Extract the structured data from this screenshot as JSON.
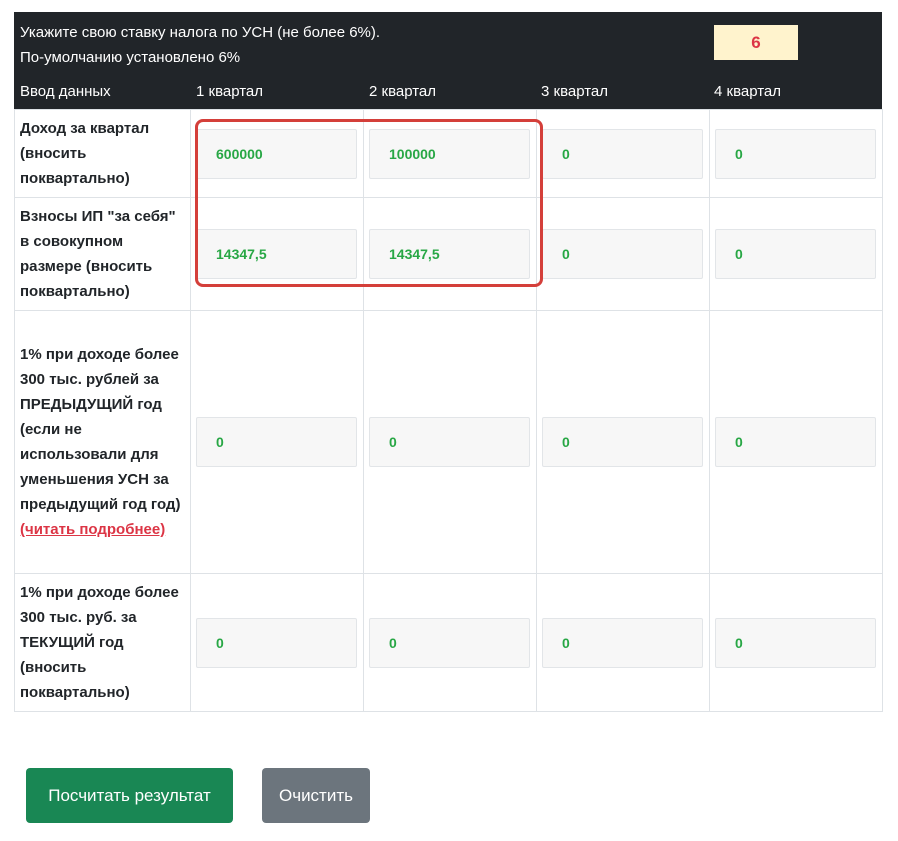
{
  "header": {
    "rate_line1": "Укажите свою ставку налога по УСН (не более 6%).",
    "rate_line2": "По-умолчанию установлено 6%",
    "rate_value": "6",
    "columns": [
      "Ввод данных",
      "1 квартал",
      "2 квартал",
      "3 квартал",
      "4 квартал"
    ]
  },
  "rows": [
    {
      "label": "Доход за квартал (вносить поквартально)",
      "values": [
        "600000",
        "100000",
        "0",
        "0"
      ]
    },
    {
      "label": "Взносы ИП \"за себя\" в совокупном размере (вносить поквартально)",
      "values": [
        "14347,5",
        "14347,5",
        "0",
        "0"
      ]
    },
    {
      "label": "1% при доходе более 300 тыс. рублей за ПРЕДЫДУЩИЙ год (если не использовали для уменьшения УСН за предыдущий год год)",
      "link": "(читать подробнее)",
      "values": [
        "0",
        "0",
        "0",
        "0"
      ]
    },
    {
      "label": "1% при доходе более 300 тыс. руб. за ТЕКУЩИЙ год (вносить поквартально)",
      "values": [
        "0",
        "0",
        "0",
        "0"
      ]
    }
  ],
  "buttons": {
    "calculate": "Посчитать результат",
    "clear": "Очистить"
  },
  "colors": {
    "header_bg": "#212529",
    "value_text": "#28a745",
    "rate_text": "#dc3545",
    "rate_bg": "#fff3cd",
    "highlight": "#d43f3a",
    "calc_button": "#198754",
    "clear_button": "#6c757d"
  }
}
